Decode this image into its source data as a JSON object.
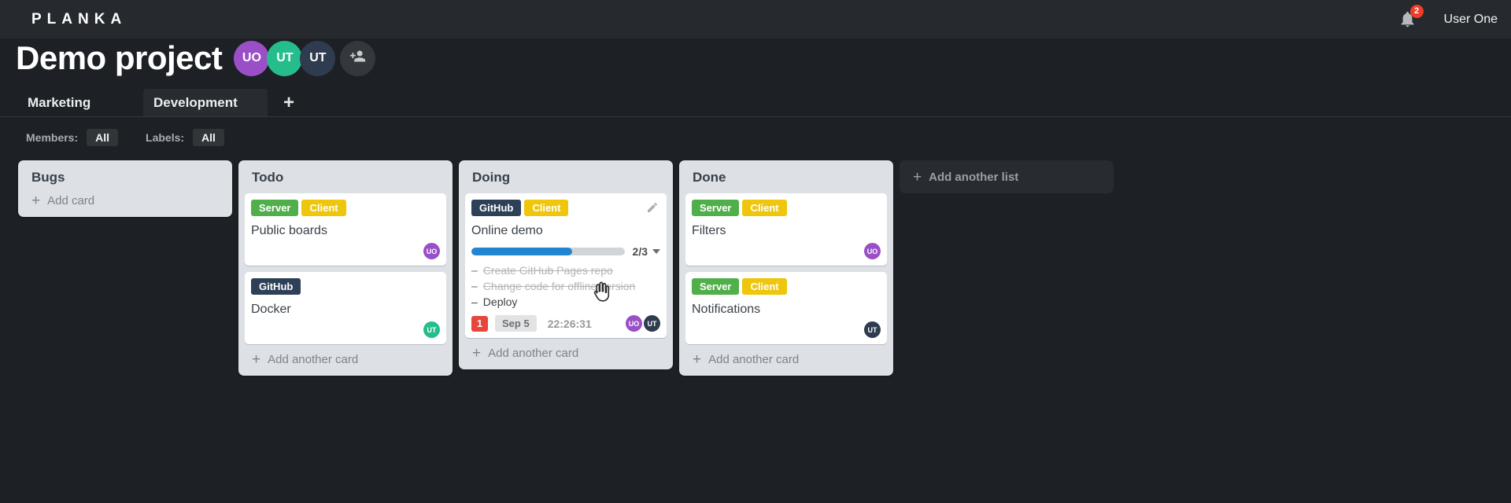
{
  "topbar": {
    "logo": "PLANKA",
    "username": "User One",
    "notification_count": "2"
  },
  "project": {
    "title": "Demo project"
  },
  "project_members": [
    {
      "initials": "UO",
      "color": "#9a4fc7"
    },
    {
      "initials": "UT",
      "color": "#26bd8c"
    },
    {
      "initials": "UT",
      "color": "#2f3b4e"
    }
  ],
  "tabs": [
    {
      "label": "Marketing",
      "active": false
    },
    {
      "label": "Development",
      "active": true
    }
  ],
  "filterbar": {
    "members_label": "Members:",
    "members_value": "All",
    "labels_label": "Labels:",
    "labels_value": "All"
  },
  "icons": {
    "plus": "+",
    "task_dash": "–"
  },
  "board": {
    "add_list_label": "Add another list",
    "lists": [
      {
        "title": "Bugs",
        "add_label": "Add card",
        "cards": []
      },
      {
        "title": "Todo",
        "add_label": "Add another card",
        "cards": [
          {
            "labels": [
              {
                "text": "Server",
                "color": "#51af4b"
              },
              {
                "text": "Client",
                "color": "#eec60b"
              }
            ],
            "title": "Public boards",
            "members": [
              {
                "initials": "UO",
                "color": "#9a4fc7"
              }
            ]
          },
          {
            "labels": [
              {
                "text": "GitHub",
                "color": "#2e4057"
              }
            ],
            "title": "Docker",
            "members": [
              {
                "initials": "UT",
                "color": "#26bd8c"
              }
            ]
          }
        ]
      },
      {
        "title": "Doing",
        "add_label": "Add another card",
        "cards": [
          {
            "labels": [
              {
                "text": "GitHub",
                "color": "#2e4057"
              },
              {
                "text": "Client",
                "color": "#eec60b"
              }
            ],
            "title": "Online demo",
            "editable": true,
            "progress": {
              "completed": 2,
              "total": 3,
              "percent": 66,
              "label": "2/3",
              "color": "#2185d0"
            },
            "tasks": [
              {
                "text": "Create GitHub Pages repo",
                "done": true
              },
              {
                "text": "Change code for offline version",
                "done": true
              },
              {
                "text": "Deploy",
                "done": false
              }
            ],
            "notification_count": "1",
            "due_date": "Sep 5",
            "timer": "22:26:31",
            "members": [
              {
                "initials": "UO",
                "color": "#9a4fc7"
              },
              {
                "initials": "UT",
                "color": "#2f3b4e"
              }
            ]
          }
        ]
      },
      {
        "title": "Done",
        "add_label": "Add another card",
        "cards": [
          {
            "labels": [
              {
                "text": "Server",
                "color": "#51af4b"
              },
              {
                "text": "Client",
                "color": "#eec60b"
              }
            ],
            "title": "Filters",
            "members": [
              {
                "initials": "UO",
                "color": "#9a4fc7"
              }
            ]
          },
          {
            "labels": [
              {
                "text": "Server",
                "color": "#51af4b"
              },
              {
                "text": "Client",
                "color": "#eec60b"
              }
            ],
            "title": "Notifications",
            "members": [
              {
                "initials": "UT",
                "color": "#2f3b4e"
              }
            ]
          }
        ]
      }
    ]
  }
}
